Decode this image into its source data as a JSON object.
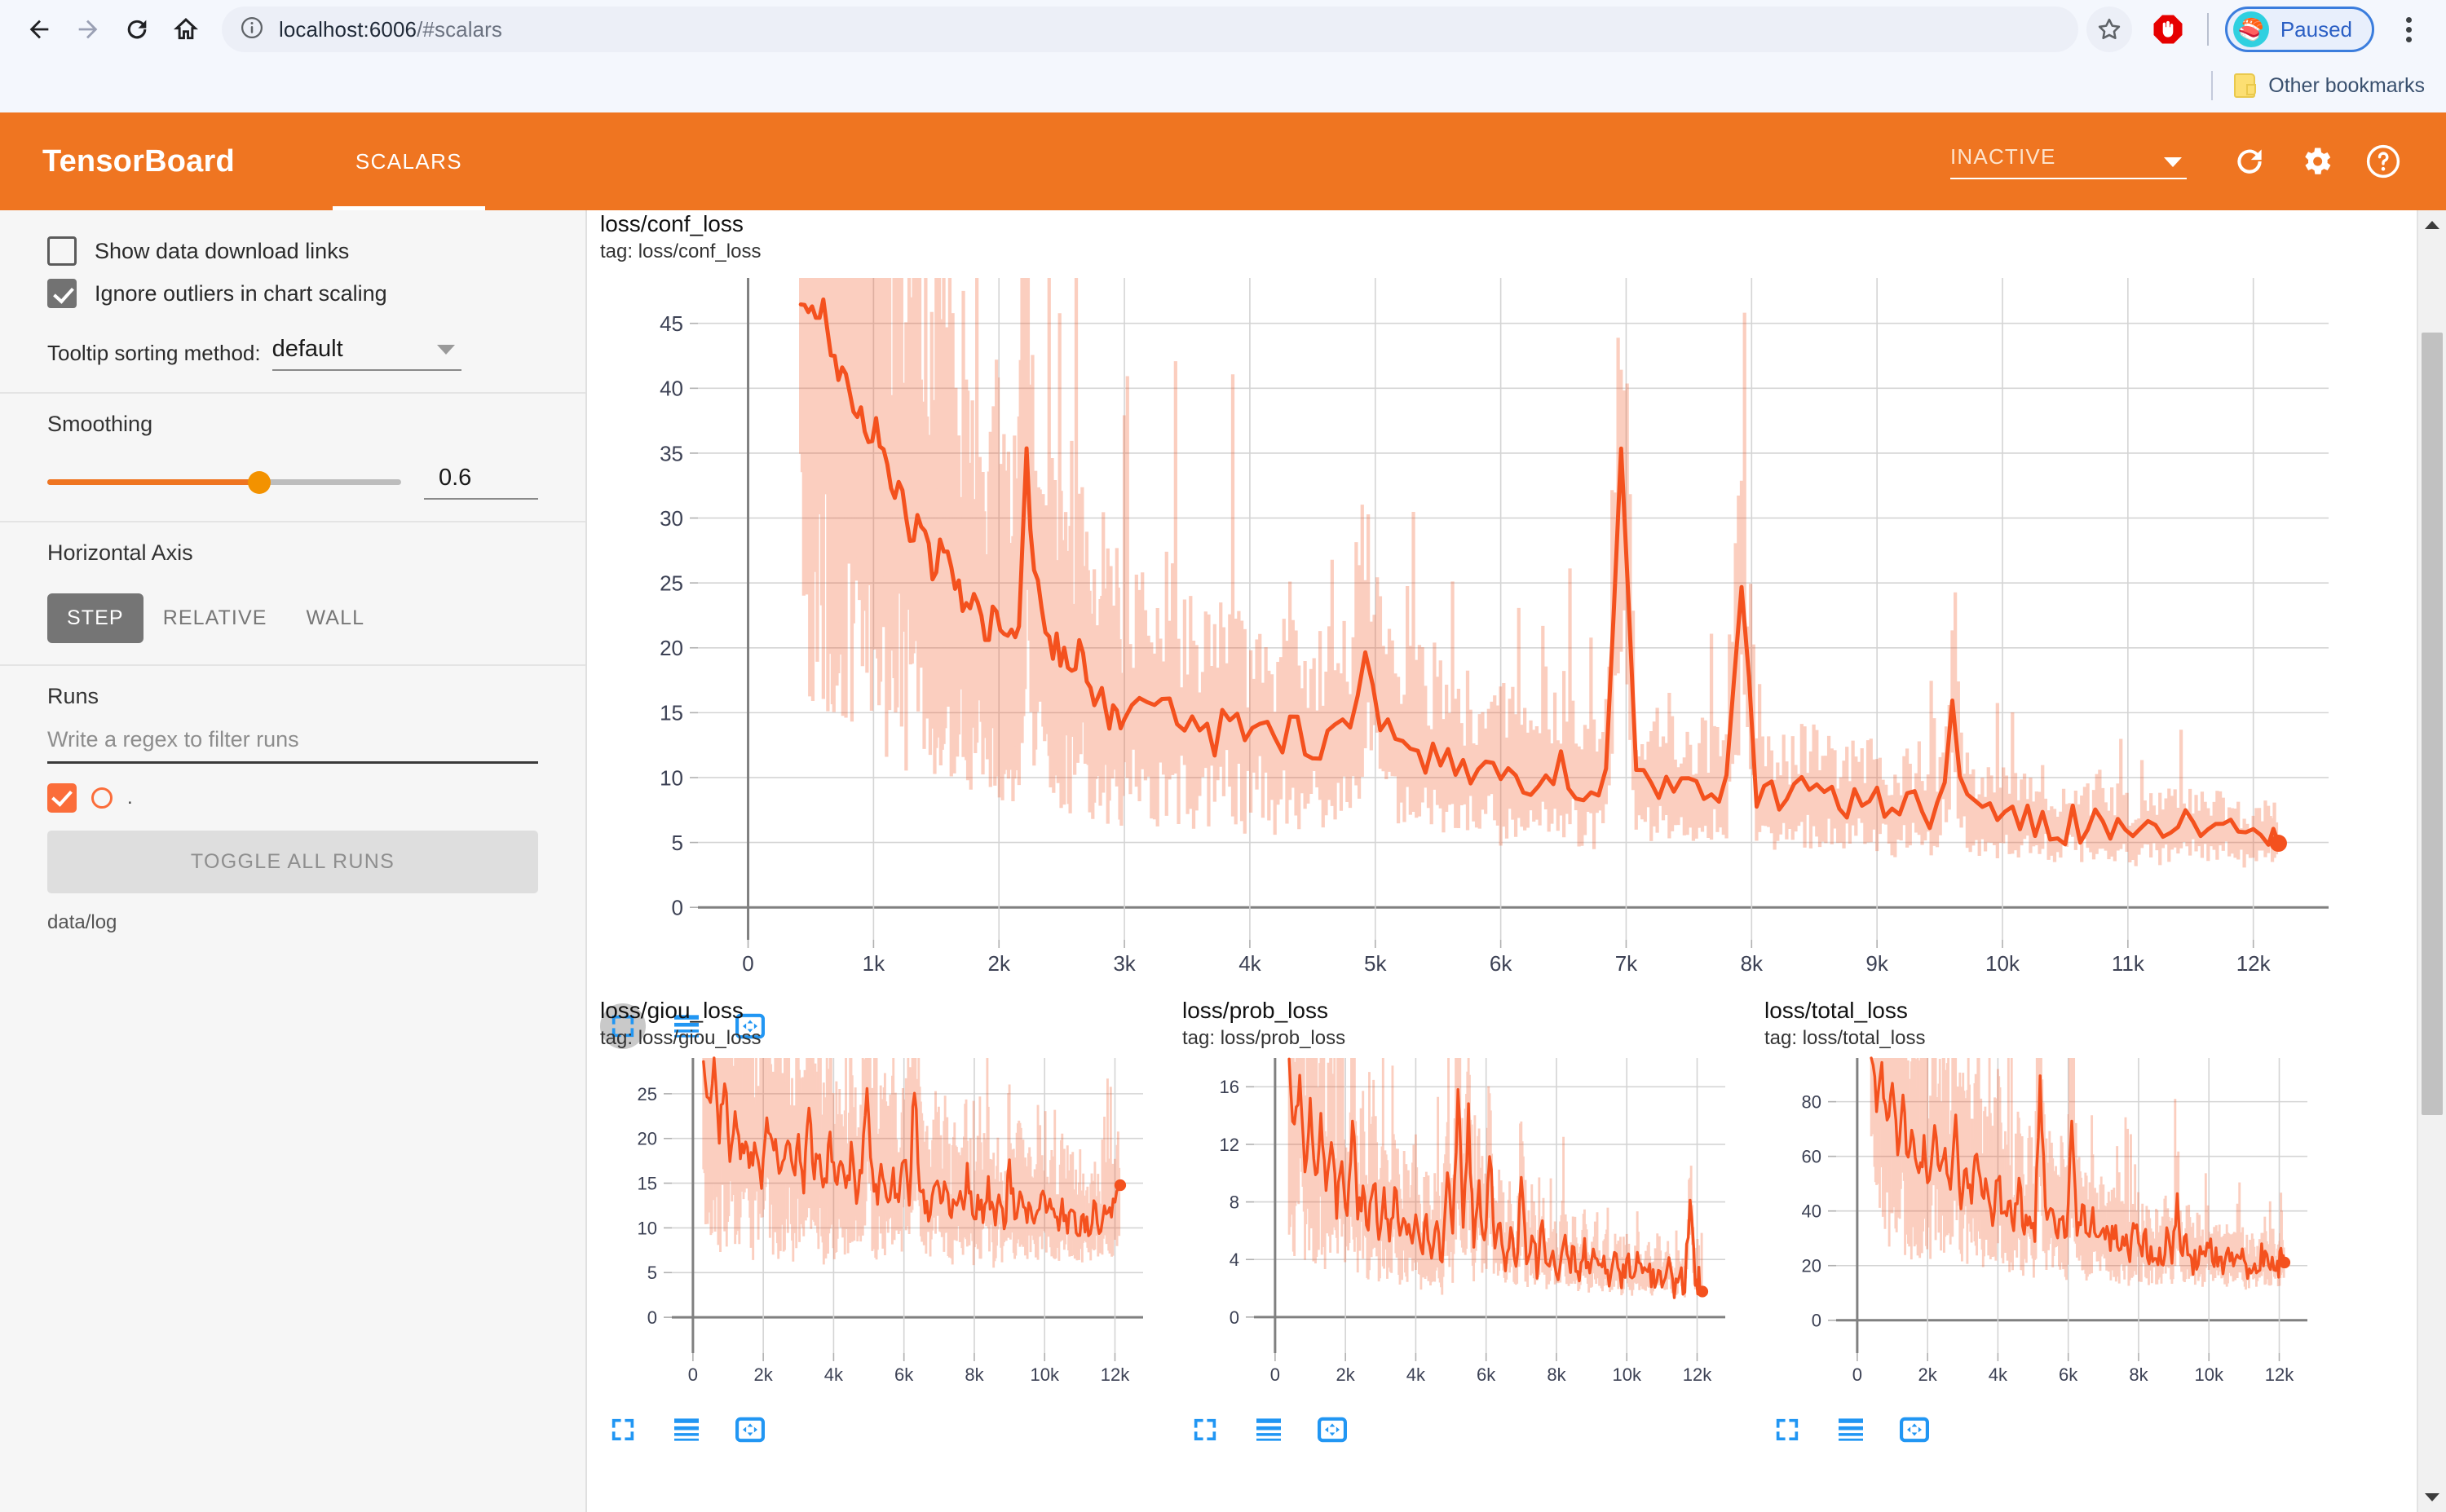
{
  "browser": {
    "url_host": "localhost:6006",
    "url_path": "/#scalars",
    "back_icon": "back-arrow-icon",
    "forward_icon": "forward-arrow-icon",
    "reload_icon": "reload-icon",
    "home_icon": "home-icon",
    "info_icon": "site-info-icon",
    "star_icon": "bookmark-star-icon",
    "extension_icon": "adblock-icon",
    "profile_label": "Paused",
    "avatar_glyph": "🍣",
    "menu_icon": "kebab-menu-icon",
    "bookmarks_label": "Other bookmarks",
    "folder_icon": "folder-icon"
  },
  "header": {
    "logo": "TensorBoard",
    "tabs": [
      {
        "label": "SCALARS",
        "active": true
      }
    ],
    "run_selector_value": "INACTIVE",
    "refresh_icon": "refresh-icon",
    "settings_icon": "gear-icon",
    "help_icon": "help-icon",
    "bg_color": "#ef7521"
  },
  "sidebar": {
    "show_download_links": {
      "label": "Show data download links",
      "checked": false
    },
    "ignore_outliers": {
      "label": "Ignore outliers in chart scaling",
      "checked": true
    },
    "tooltip_sorting": {
      "label": "Tooltip sorting method:",
      "value": "default"
    },
    "smoothing": {
      "label": "Smoothing",
      "value": "0.6",
      "fraction": 0.6
    },
    "horizontal_axis": {
      "label": "Horizontal Axis",
      "options": [
        "STEP",
        "RELATIVE",
        "WALL"
      ],
      "selected": "STEP"
    },
    "runs": {
      "label": "Runs",
      "filter_placeholder": "Write a regex to filter runs",
      "items": [
        {
          "name": ".",
          "checked": true,
          "color": "#fb6d3a"
        }
      ],
      "toggle_all_label": "TOGGLE ALL RUNS",
      "path": "data/log"
    }
  },
  "chart_tools": {
    "expand_icon": "expand-icon",
    "data_table_icon": "data-table-icon",
    "pan_icon": "pan-icon"
  },
  "chart_data": [
    {
      "id": "conf_loss",
      "type": "line",
      "title": "loss/conf_loss",
      "tag": "tag: loss/conf_loss",
      "xlabel": "",
      "ylabel": "",
      "xticks": [
        0,
        1000,
        2000,
        3000,
        4000,
        5000,
        6000,
        7000,
        8000,
        9000,
        10000,
        11000,
        12000
      ],
      "xticklabels": [
        "0",
        "1k",
        "2k",
        "3k",
        "4k",
        "5k",
        "6k",
        "7k",
        "8k",
        "9k",
        "10k",
        "11k",
        "12k"
      ],
      "yticks": [
        0,
        5,
        10,
        15,
        20,
        25,
        30,
        35,
        40,
        45
      ],
      "yticklabels": [
        "0",
        "5",
        "10",
        "15",
        "20",
        "25",
        "30",
        "35",
        "40",
        "45"
      ],
      "xlim": [
        -400,
        12600
      ],
      "ylim": [
        -2.5,
        48.5
      ],
      "grid": true,
      "legend": "none",
      "series": [
        {
          "name": "data/log (smoothed)",
          "color": "#f4511e",
          "x": [
            420,
            480,
            540,
            600,
            660,
            720,
            780,
            840,
            900,
            960,
            1020,
            1080,
            1140,
            1200,
            1260,
            1320,
            1380,
            1440,
            1500,
            1560,
            1620,
            1680,
            1740,
            1800,
            1860,
            1920,
            1980,
            2040,
            2100,
            2160,
            2220,
            2280,
            2340,
            2400,
            2460,
            2520,
            2580,
            2640,
            2700,
            2760,
            2820,
            2880,
            2940,
            3000,
            3120,
            3240,
            3360,
            3480,
            3600,
            3720,
            3840,
            3960,
            4080,
            4200,
            4320,
            4440,
            4560,
            4680,
            4800,
            4920,
            5040,
            5160,
            5280,
            5400,
            5520,
            5640,
            5760,
            5880,
            6000,
            6120,
            6240,
            6360,
            6480,
            6600,
            6720,
            6840,
            6960,
            7080,
            7200,
            7320,
            7440,
            7560,
            7680,
            7800,
            7920,
            8040,
            8160,
            8280,
            8400,
            8520,
            8640,
            8760,
            8880,
            9000,
            9120,
            9240,
            9360,
            9480,
            9600,
            9720,
            9840,
            9960,
            10080,
            10200,
            10320,
            10440,
            10560,
            10680,
            10800,
            10920,
            11040,
            11160,
            11280,
            11400,
            11520,
            11640,
            11760,
            11880,
            12000,
            12120,
            12200
          ],
          "y": [
            47.5,
            46,
            44.5,
            46.5,
            43,
            41,
            42,
            39,
            38,
            36,
            37,
            34,
            32,
            33,
            30,
            29,
            30,
            27,
            26,
            28,
            25,
            24,
            23,
            24,
            22,
            21,
            23,
            21,
            20,
            22,
            34,
            26,
            22,
            21,
            20,
            19,
            18,
            20,
            17,
            16,
            18,
            15,
            16,
            14,
            15,
            14.5,
            16,
            13.5,
            14,
            13,
            15,
            13,
            14,
            12,
            14.5,
            13,
            12.5,
            13.5,
            14,
            20,
            15,
            13,
            12,
            11.5,
            12,
            11,
            10.5,
            11,
            10,
            10.5,
            9.5,
            10,
            11,
            9.5,
            9,
            10,
            35,
            9.5,
            9,
            10.5,
            9,
            8.5,
            9,
            10,
            25,
            9,
            8.5,
            8,
            9,
            8.5,
            8,
            7.5,
            8.5,
            8,
            7,
            7.5,
            8,
            7,
            15,
            7.5,
            7,
            6.5,
            7,
            6.5,
            7,
            6,
            6.5,
            6,
            7,
            6,
            5.5,
            6,
            5.5,
            6.5,
            6,
            5.5,
            6,
            5.5,
            5,
            6,
            5.5,
            5,
            5.5,
            5,
            6,
            7
          ]
        },
        {
          "name": "data/log (raw)",
          "color": "#f4511e",
          "opacity": 0.25,
          "description": "unsmoothed high-variance envelope around the smoothed line"
        }
      ],
      "last_point_marker": true
    },
    {
      "id": "giou_loss",
      "type": "line",
      "title": "loss/giou_loss",
      "tag": "tag: loss/giou_loss",
      "xticks": [
        0,
        2000,
        4000,
        6000,
        8000,
        10000,
        12000
      ],
      "xticklabels": [
        "0",
        "2k",
        "4k",
        "6k",
        "8k",
        "10k",
        "12k"
      ],
      "yticks": [
        0,
        5,
        10,
        15,
        20,
        25
      ],
      "yticklabels": [
        "0",
        "5",
        "10",
        "15",
        "20",
        "25"
      ],
      "xlim": [
        -600,
        12800
      ],
      "ylim": [
        -4,
        29
      ],
      "grid": true,
      "series": [
        {
          "name": "data/log",
          "color": "#f4511e",
          "x": [
            300,
            450,
            600,
            750,
            900,
            1050,
            1200,
            1350,
            1500,
            1650,
            1800,
            1950,
            2100,
            2250,
            2400,
            2550,
            2700,
            2850,
            3000,
            3150,
            3300,
            3450,
            3600,
            3750,
            3900,
            4050,
            4200,
            4350,
            4500,
            4650,
            4800,
            4950,
            5100,
            5250,
            5400,
            5550,
            5700,
            5850,
            6000,
            6150,
            6300,
            6450,
            6600,
            6750,
            6900,
            7050,
            7200,
            7350,
            7500,
            7650,
            7800,
            7950,
            8100,
            8250,
            8400,
            8550,
            8700,
            8850,
            9000,
            9150,
            9300,
            9450,
            9600,
            9750,
            9900,
            10050,
            10200,
            10350,
            10500,
            10650,
            10800,
            10950,
            11100,
            11250,
            11400,
            11550,
            11700,
            11850,
            12000,
            12150
          ],
          "y": [
            27,
            24,
            28,
            21,
            26,
            19,
            23,
            18,
            21,
            17,
            20,
            16,
            22,
            19,
            18,
            17,
            21,
            16,
            19,
            15,
            23,
            16,
            18,
            14,
            20,
            15,
            17,
            13,
            18,
            14,
            16,
            25,
            15,
            13,
            17,
            14,
            16,
            12,
            19,
            14,
            26,
            15,
            13,
            12,
            16,
            13,
            15,
            11,
            14,
            12,
            16,
            11,
            13,
            12,
            15,
            11,
            13,
            10,
            17,
            12,
            14,
            11,
            13,
            10,
            14,
            11,
            12,
            10,
            13,
            11,
            12,
            10,
            11,
            9,
            12,
            10,
            13,
            11,
            12,
            14.5
          ]
        }
      ],
      "last_point_marker": true
    },
    {
      "id": "prob_loss",
      "type": "line",
      "title": "loss/prob_loss",
      "tag": "tag: loss/prob_loss",
      "xticks": [
        0,
        2000,
        4000,
        6000,
        8000,
        10000,
        12000
      ],
      "xticklabels": [
        "0",
        "2k",
        "4k",
        "6k",
        "8k",
        "10k",
        "12k"
      ],
      "yticks": [
        0,
        4,
        8,
        12,
        16
      ],
      "yticklabels": [
        "0",
        "4",
        "8",
        "12",
        "16"
      ],
      "xlim": [
        -600,
        12800
      ],
      "ylim": [
        -2.5,
        18
      ],
      "grid": true,
      "series": [
        {
          "name": "data/log",
          "color": "#f4511e",
          "x": [
            400,
            550,
            700,
            850,
            1000,
            1150,
            1300,
            1450,
            1600,
            1750,
            1900,
            2050,
            2200,
            2350,
            2500,
            2650,
            2800,
            2950,
            3100,
            3250,
            3400,
            3550,
            3700,
            3850,
            4000,
            4150,
            4300,
            4450,
            4600,
            4750,
            4900,
            5050,
            5200,
            5350,
            5500,
            5650,
            5800,
            5950,
            6100,
            6250,
            6400,
            6550,
            6700,
            6850,
            7000,
            7150,
            7300,
            7450,
            7600,
            7750,
            7900,
            8050,
            8200,
            8350,
            8500,
            8650,
            8800,
            8950,
            9100,
            9250,
            9400,
            9550,
            9700,
            9850,
            10000,
            10150,
            10300,
            10450,
            10600,
            10750,
            10900,
            11050,
            11200,
            11350,
            11500,
            11650,
            11800,
            11950,
            12050,
            12150
          ],
          "y": [
            17,
            13,
            17,
            10,
            15,
            9,
            14,
            8,
            13,
            7.5,
            11,
            6.5,
            14,
            7,
            9,
            6,
            10,
            5.5,
            8,
            5,
            9,
            5.5,
            7,
            5,
            8,
            4.5,
            6.5,
            4,
            7,
            3.5,
            10,
            5,
            16,
            6,
            14,
            5,
            9.5,
            4.5,
            12,
            5,
            7,
            4,
            6,
            3.5,
            9.5,
            4,
            5.5,
            3.5,
            6,
            3.5,
            5,
            3,
            5.5,
            3,
            4.5,
            3,
            5,
            2.8,
            4.5,
            2.8,
            4,
            2.6,
            4.2,
            2.6,
            3.8,
            2.5,
            4,
            2.5,
            3.5,
            2.4,
            4,
            2.4,
            3.6,
            2.3,
            3.2,
            2.3,
            7.8,
            2.6,
            2.5,
            2.6
          ]
        }
      ],
      "last_point_marker": true
    },
    {
      "id": "total_loss",
      "type": "line",
      "title": "loss/total_loss",
      "tag": "tag: loss/total_loss",
      "xticks": [
        0,
        2000,
        4000,
        6000,
        8000,
        10000,
        12000
      ],
      "xticklabels": [
        "0",
        "2k",
        "4k",
        "6k",
        "8k",
        "10k",
        "12k"
      ],
      "yticks": [
        0,
        20,
        40,
        60,
        80
      ],
      "yticklabels": [
        "0",
        "20",
        "40",
        "60",
        "80"
      ],
      "xlim": [
        -600,
        12800
      ],
      "ylim": [
        -12,
        96
      ],
      "grid": true,
      "series": [
        {
          "name": "data/log",
          "color": "#f4511e",
          "x": [
            400,
            550,
            700,
            850,
            1000,
            1150,
            1300,
            1450,
            1600,
            1750,
            1900,
            2050,
            2200,
            2350,
            2500,
            2650,
            2800,
            2950,
            3100,
            3250,
            3400,
            3550,
            3700,
            3850,
            4000,
            4150,
            4300,
            4450,
            4600,
            4750,
            4900,
            5050,
            5200,
            5350,
            5500,
            5650,
            5800,
            5950,
            6100,
            6250,
            6400,
            6550,
            6700,
            6850,
            7000,
            7150,
            7300,
            7450,
            7600,
            7750,
            7900,
            8050,
            8200,
            8350,
            8500,
            8650,
            8800,
            8950,
            9100,
            9250,
            9400,
            9550,
            9700,
            9850,
            10000,
            10150,
            10300,
            10450,
            10600,
            10750,
            10900,
            11050,
            11200,
            11350,
            11500,
            11650,
            11800,
            11950,
            12050,
            12150
          ],
          "y": [
            95,
            80,
            92,
            68,
            85,
            62,
            78,
            58,
            70,
            52,
            65,
            50,
            76,
            52,
            58,
            48,
            72,
            46,
            55,
            44,
            62,
            42,
            50,
            40,
            55,
            38,
            45,
            35,
            48,
            34,
            42,
            32,
            90,
            38,
            44,
            33,
            40,
            30,
            76,
            34,
            40,
            30,
            36,
            28,
            38,
            28,
            32,
            26,
            30,
            24,
            34,
            24,
            28,
            23,
            26,
            22,
            30,
            23,
            41,
            24,
            27,
            22,
            25,
            21,
            28,
            22,
            24,
            20,
            26,
            21,
            23,
            19,
            22,
            18,
            24,
            20,
            22,
            19,
            21,
            24
          ]
        }
      ],
      "last_point_marker": true
    }
  ]
}
